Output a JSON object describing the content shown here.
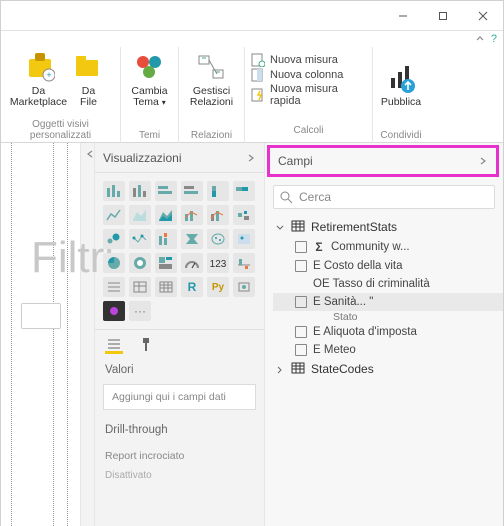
{
  "watermark": "Filtri",
  "ribbon": {
    "visuals": {
      "marketplace": "Da\nMarketplace",
      "file": "Da\nFile",
      "group": "Oggetti visivi personalizzati"
    },
    "themes": {
      "switch": "Cambia\nTema",
      "group": "Temi"
    },
    "relations": {
      "manage": "Gestisci\nRelazioni",
      "group": "Relazioni"
    },
    "calc": {
      "measure": "Nuova misura",
      "column": "Nuova colonna",
      "quick": "Nuova misura rapida",
      "group": "Calcoli"
    },
    "publish": {
      "btn": "Pubblica",
      "group": "Condividi"
    }
  },
  "viz": {
    "header": "Visualizzazioni",
    "tiles": {
      "r": "R",
      "py": "Py",
      "more": "···"
    },
    "values": "Valori",
    "well_hint": "Aggiungi qui i campi dati",
    "drill": "Drill-through",
    "cross": "Report incrociato",
    "off": "Disattivato"
  },
  "fields": {
    "header": "Campi",
    "search_placeholder": "Cerca",
    "tables": [
      {
        "name": "RetirementStats",
        "expanded": true,
        "fields": [
          {
            "label": "Community w...",
            "sigma": true
          },
          {
            "label": "E Costo della vita"
          },
          {
            "label": "OE Tasso di criminalità",
            "nocheck": true
          },
          {
            "label": "E Sanità... \"",
            "selected": true,
            "sub": "Stato"
          },
          {
            "label": "E Aliquota d'imposta"
          },
          {
            "label": "E Meteo"
          }
        ]
      },
      {
        "name": "StateCodes",
        "expanded": false
      }
    ]
  }
}
